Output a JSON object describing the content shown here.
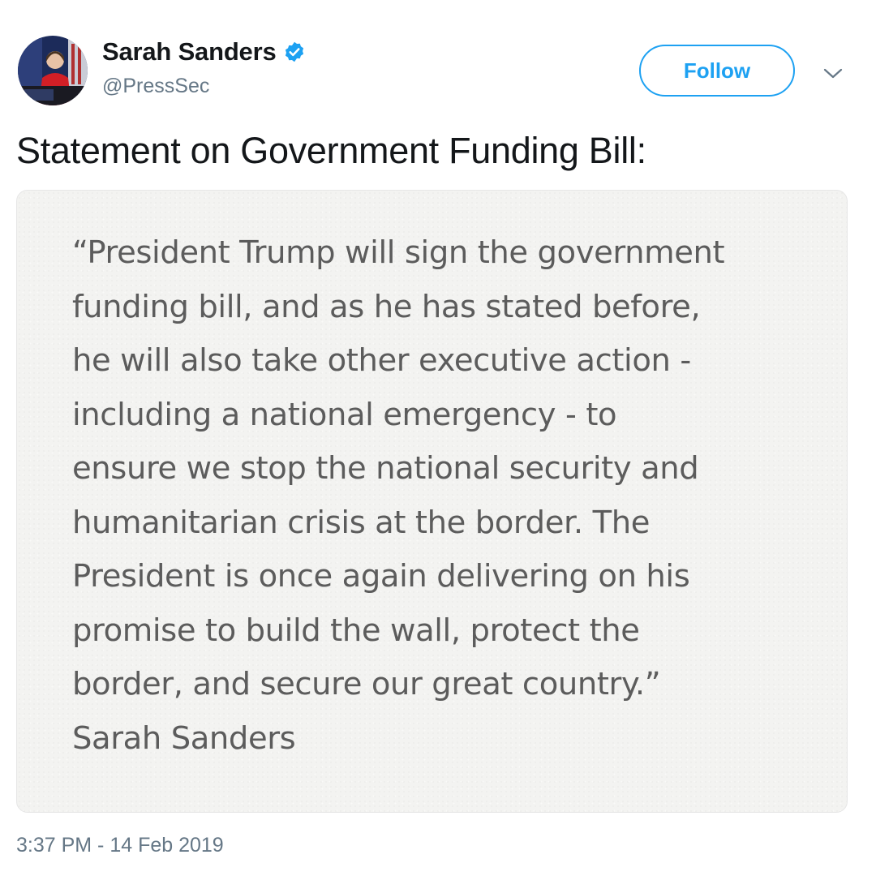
{
  "author": {
    "display_name": "Sarah Sanders",
    "handle": "@PressSec",
    "verified": true,
    "avatar_icon": "profile-photo-icon",
    "verified_icon": "verified-badge-icon"
  },
  "follow": {
    "label": "Follow",
    "color": "#1da1f2"
  },
  "menu": {
    "icon": "chevron-down-icon"
  },
  "tweet": {
    "text": "Statement on Government Funding Bill:",
    "timestamp": "3:37 PM - 14 Feb 2019"
  },
  "statement_image": {
    "lines": [
      "“President Trump will sign the government",
      "funding bill, and as he has stated before,",
      "he will also take other executive action -",
      "including a national emergency - to",
      "ensure we stop the national security and",
      "humanitarian crisis at the border. The",
      "President is once again delivering on his",
      "promise to build the wall, protect the",
      "border, and secure our great country.”",
      "Sarah Sanders"
    ]
  }
}
